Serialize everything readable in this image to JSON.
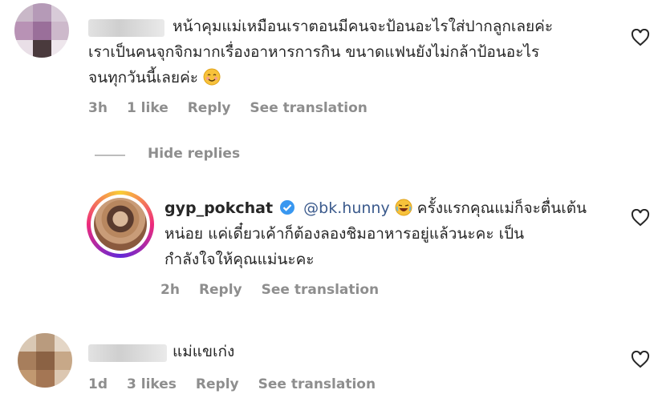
{
  "comments": [
    {
      "text_lines": [
        "หน้าคุมแม่เหมือนเราตอนมีคนจะป้อนอะไรใส่ปากลูกเลยค่ะ",
        "เราเป็นคนจุกจิกมากเรื่องอาหารการกิน ขนาดแฟนยังไม่กล้าป้อนอะไร",
        "จนทุกวันนี้เลยค่ะ"
      ],
      "emoji": "smiling-face-emoji",
      "time": "3h",
      "likes": "1 like",
      "reply": "Reply",
      "translate": "See translation"
    },
    {
      "text_lines": [
        "แม่แขเก่ง"
      ],
      "time": "1d",
      "likes": "3 likes",
      "reply": "Reply",
      "translate": "See translation"
    }
  ],
  "hide_replies": "Hide replies",
  "reply": {
    "username": "gyp_pokchat",
    "mention": "@bk.hunny",
    "emoji": "laughing-emoji",
    "text_lines": [
      "ครั้งแรกคุณแม่ก็จะตื่นเต้น",
      "หน่อย แค่เดี๋ยวเค้าก็ต้องลองชิมอาหารอยู่แล้วนะคะ เป็น",
      "กำลังใจให้คุณแม่นะคะ"
    ],
    "time": "2h",
    "reply": "Reply",
    "translate": "See translation"
  },
  "colors": {
    "text": "#262626",
    "muted": "#8e8e8e",
    "mention": "#3b5a8c",
    "verified": "#3897f0"
  }
}
